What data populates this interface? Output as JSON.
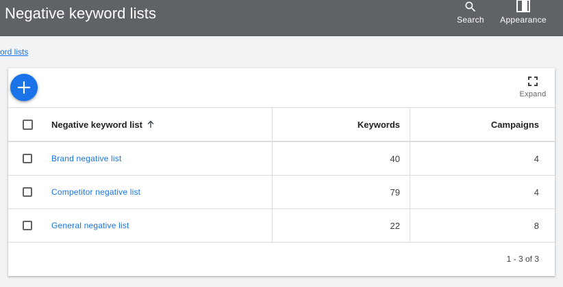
{
  "header": {
    "title": "Negative keyword lists",
    "search_label": "Search",
    "appearance_label": "Appearance"
  },
  "breadcrumb": {
    "text": "ord lists"
  },
  "toolbar": {
    "expand_label": "Expand"
  },
  "table": {
    "columns": {
      "name": "Negative keyword list",
      "keywords": "Keywords",
      "campaigns": "Campaigns"
    },
    "rows": [
      {
        "name": "Brand negative list",
        "keywords": "40",
        "campaigns": "4"
      },
      {
        "name": "Competitor negative list",
        "keywords": "79",
        "campaigns": "4"
      },
      {
        "name": "General negative list",
        "keywords": "22",
        "campaigns": "8"
      }
    ],
    "pagination": "1 - 3 of 3"
  },
  "colors": {
    "topbar": "#5f6368",
    "accent": "#1a73e8"
  }
}
